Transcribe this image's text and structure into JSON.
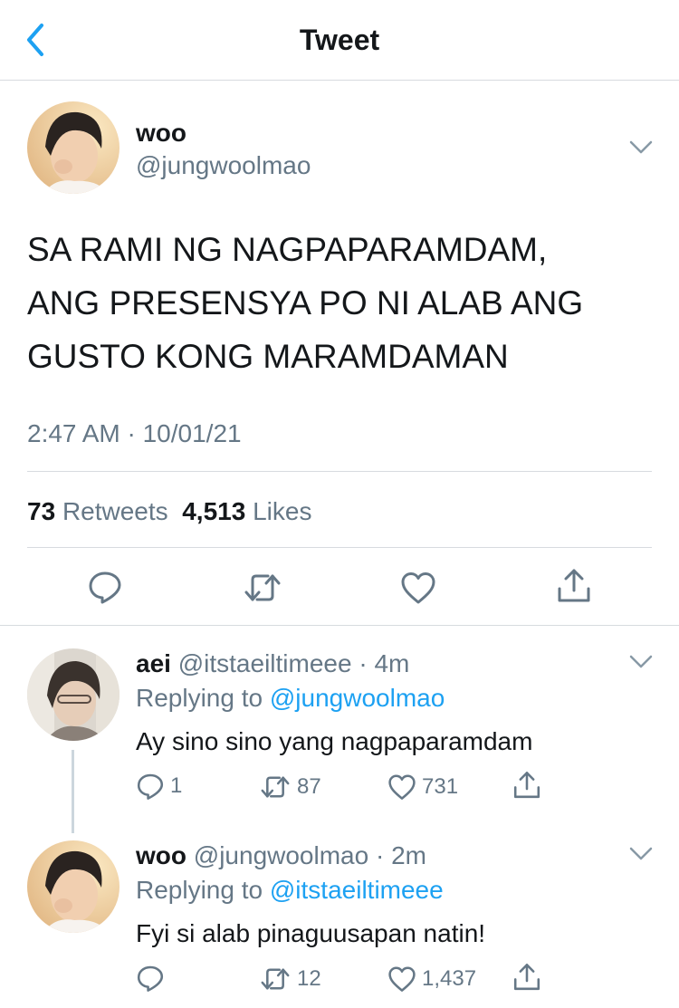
{
  "header": {
    "title": "Tweet"
  },
  "tweet": {
    "name": "woo",
    "handle": "@jungwoolmao",
    "text_lines": [
      "SA RAMI NG NAGPAPARAMDAM,",
      "ANG PRESENSYA PO NI ALAB ANG",
      "GUSTO KONG MARAMDAMAN"
    ],
    "timestamp": "2:47 AM · 10/01/21",
    "retweets": "73",
    "retweets_label": "Retweets",
    "likes": "4,513",
    "likes_label": "Likes"
  },
  "replies": [
    {
      "name": "aei",
      "handle": "@itstaeiltimeee",
      "time": "· 4m",
      "replying_prefix": "Replying to",
      "replying_to": "@jungwoolmao",
      "text": "Ay sino sino yang nagpaparamdam",
      "reply_count": "1",
      "retweet_count": "87",
      "like_count": "731"
    },
    {
      "name": "woo",
      "handle": "@jungwoolmao",
      "time": "· 2m",
      "replying_prefix": "Replying to",
      "replying_to": "@itstaeiltimeee",
      "text": "Fyi si alab pinaguusapan natin!",
      "reply_count": "",
      "retweet_count": "12",
      "like_count": "1,437"
    }
  ],
  "colors": {
    "accent": "#1da1f2",
    "secondary_text": "#657786",
    "divider": "#d7dbdf"
  }
}
